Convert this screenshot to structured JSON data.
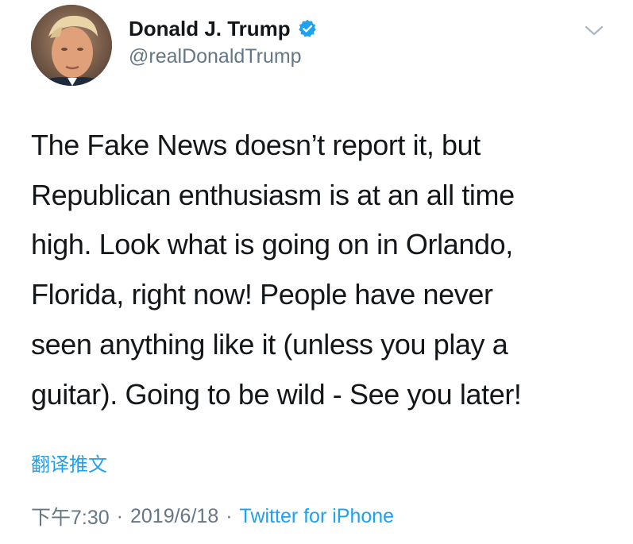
{
  "author": {
    "display_name": "Donald J. Trump",
    "handle": "@realDonaldTrump",
    "verified": true
  },
  "tweet": {
    "lines": [
      "The Fake News doesn’t report it, but",
      "Republican enthusiasm is at an all time",
      "high. Look what is going on in Orlando,",
      "Florida, right now! People have never",
      "seen anything like it (unless you play a",
      "guitar). Going to be wild - See you later!"
    ]
  },
  "actions": {
    "translate_label": "翻译推文"
  },
  "meta": {
    "time": "下午7:30",
    "separator": "·",
    "date": "2019/6/18",
    "source": "Twitter for iPhone"
  },
  "icons": {
    "verified": "verified-badge-icon",
    "menu": "chevron-down-icon"
  },
  "colors": {
    "link_blue": "#1da1f2",
    "secondary_gray": "#657786",
    "text": "#14171a"
  }
}
